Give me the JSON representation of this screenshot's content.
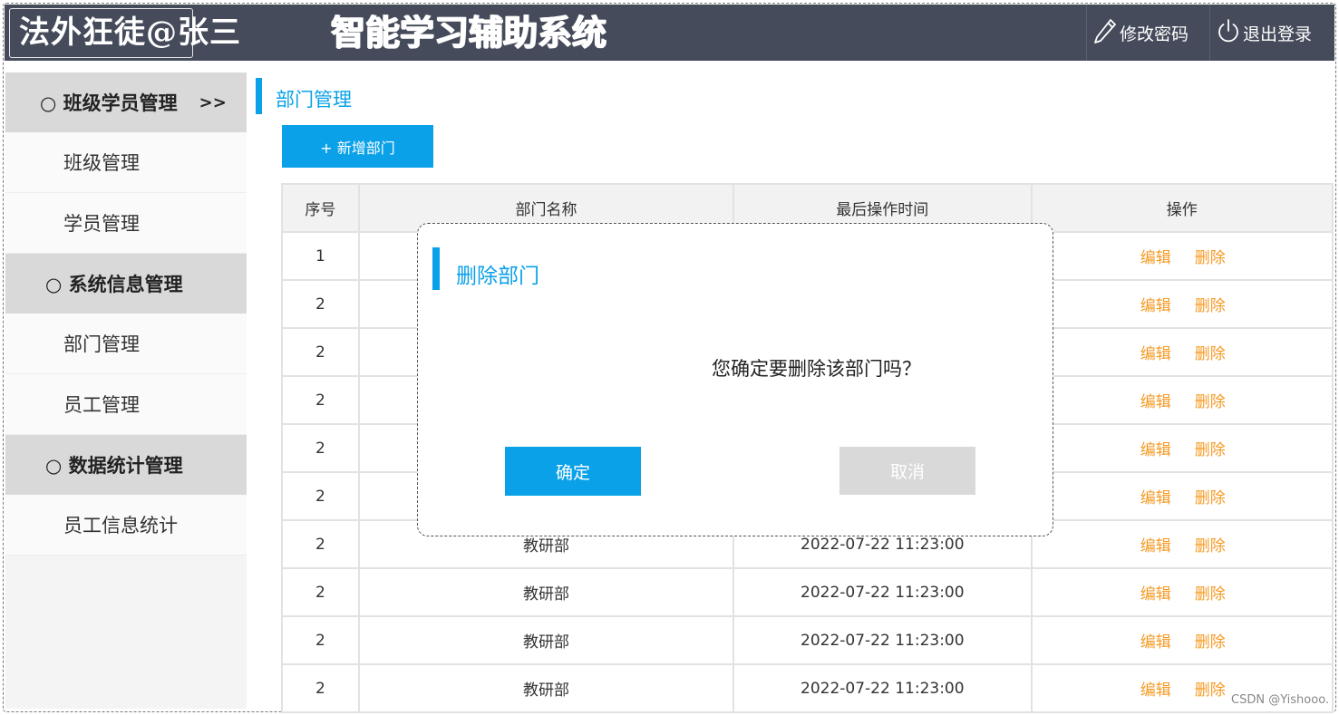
{
  "header": {
    "brand": "法外狂徒@张三",
    "title": "智能学习辅助系统",
    "change_password": "修改密码",
    "logout": "退出登录",
    "pencil_icon": "pencil-icon",
    "power_icon": "power-icon"
  },
  "sidebar": {
    "groups": [
      {
        "label": "○ 班级学员管理",
        "arrow": ">>",
        "items": [
          "班级管理",
          "学员管理"
        ]
      },
      {
        "label": "○ 系统信息管理",
        "items": [
          "部门管理",
          "员工管理"
        ]
      },
      {
        "label": "○ 数据统计管理",
        "items": [
          "员工信息统计"
        ]
      }
    ]
  },
  "main": {
    "page_title": "部门管理",
    "add_button": "+ 新增部门",
    "table": {
      "headers": [
        "序号",
        "部门名称",
        "最后操作时间",
        "操作"
      ],
      "rows": [
        [
          "1",
          "",
          "",
          "编辑",
          "删除"
        ],
        [
          "2",
          "",
          "",
          "编辑",
          "删除"
        ],
        [
          "2",
          "",
          "",
          "编辑",
          "删除"
        ],
        [
          "2",
          "",
          "",
          "编辑",
          "删除"
        ],
        [
          "2",
          "",
          "",
          "编辑",
          "删除"
        ],
        [
          "2",
          "",
          "",
          "编辑",
          "删除"
        ],
        [
          "2",
          "教研部",
          "2022-07-22 11:23:00",
          "编辑",
          "删除"
        ],
        [
          "2",
          "教研部",
          "2022-07-22 11:23:00",
          "编辑",
          "删除"
        ],
        [
          "2",
          "教研部",
          "2022-07-22 11:23:00",
          "编辑",
          "删除"
        ],
        [
          "2",
          "教研部",
          "2022-07-22 11:23:00",
          "编辑",
          "删除"
        ]
      ]
    }
  },
  "modal": {
    "title": "删除部门",
    "message": "您确定要删除该部门吗？",
    "confirm": "确定",
    "cancel": "取消"
  },
  "watermark": "CSDN @Yishooo.",
  "colors": {
    "accent": "#0aa1e8",
    "header_bg": "#454b5a",
    "action_link": "#f59a23"
  }
}
